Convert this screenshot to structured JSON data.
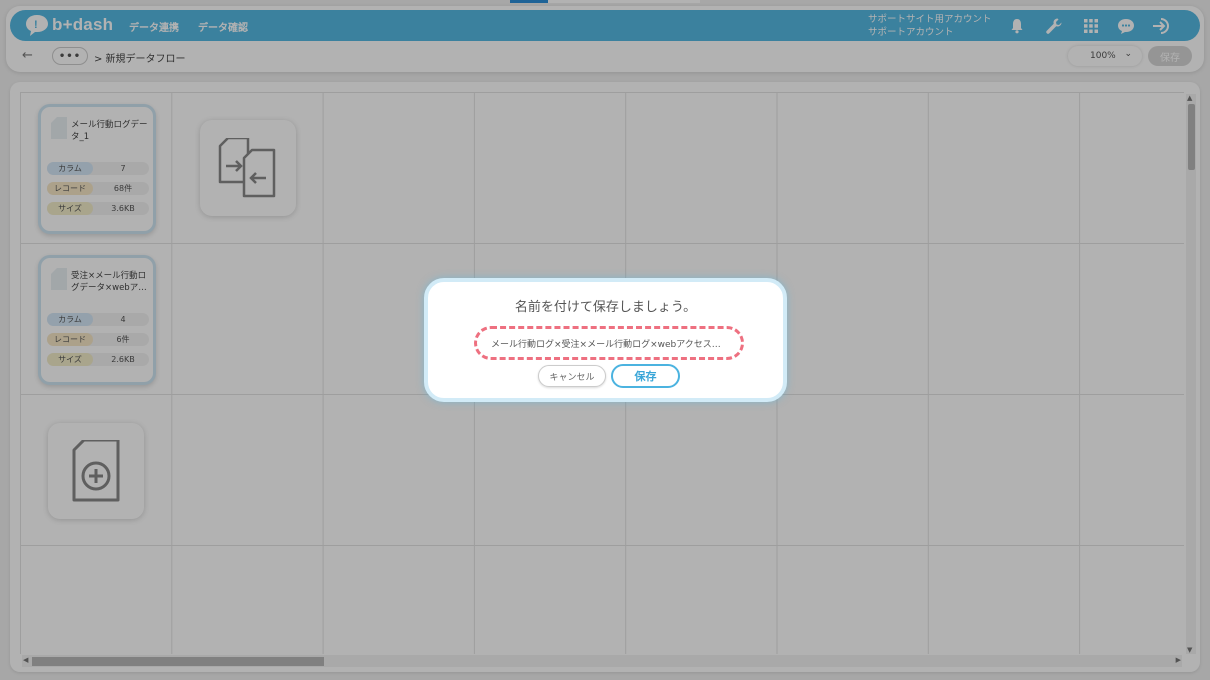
{
  "header": {
    "brand": "b+dash",
    "nav": [
      "データ連携",
      "データ確認"
    ],
    "account_line1": "サポートサイト用アカウント",
    "account_line2": "サポートアカウント",
    "icons": [
      "bell-icon",
      "wrench-icon",
      "grid-icon",
      "chat-icon",
      "logout-icon"
    ]
  },
  "toolbar": {
    "back_symbol": "←",
    "more_label": "•••",
    "breadcrumb": "> 新規データフロー",
    "zoom": "100%",
    "zoom_caret": "⌄",
    "save_label": "保存"
  },
  "cards": [
    {
      "title": "メール行動ログデータ_1",
      "stats": [
        {
          "label": "カラム",
          "value": "7"
        },
        {
          "label": "レコード",
          "value": "68件"
        },
        {
          "label": "サイズ",
          "value": "3.6KB"
        }
      ]
    },
    {
      "title": "受注×メール行動ログデータ×webア…",
      "stats": [
        {
          "label": "カラム",
          "value": "4"
        },
        {
          "label": "レコード",
          "value": "6件"
        },
        {
          "label": "サイズ",
          "value": "2.6KB"
        }
      ]
    }
  ],
  "tools": [
    "file-transfer-icon",
    "add-file-icon"
  ],
  "dialog": {
    "title": "名前を付けて保存しましょう。",
    "input_value": "メール行動ログ×受注×メール行動ログ×webアクセス…",
    "cancel_label": "キャンセル",
    "save_label": "保存"
  },
  "colors": {
    "brand": "#55b9e3",
    "input_highlight": "#ee7080",
    "save_button": "#3aa6d8"
  }
}
